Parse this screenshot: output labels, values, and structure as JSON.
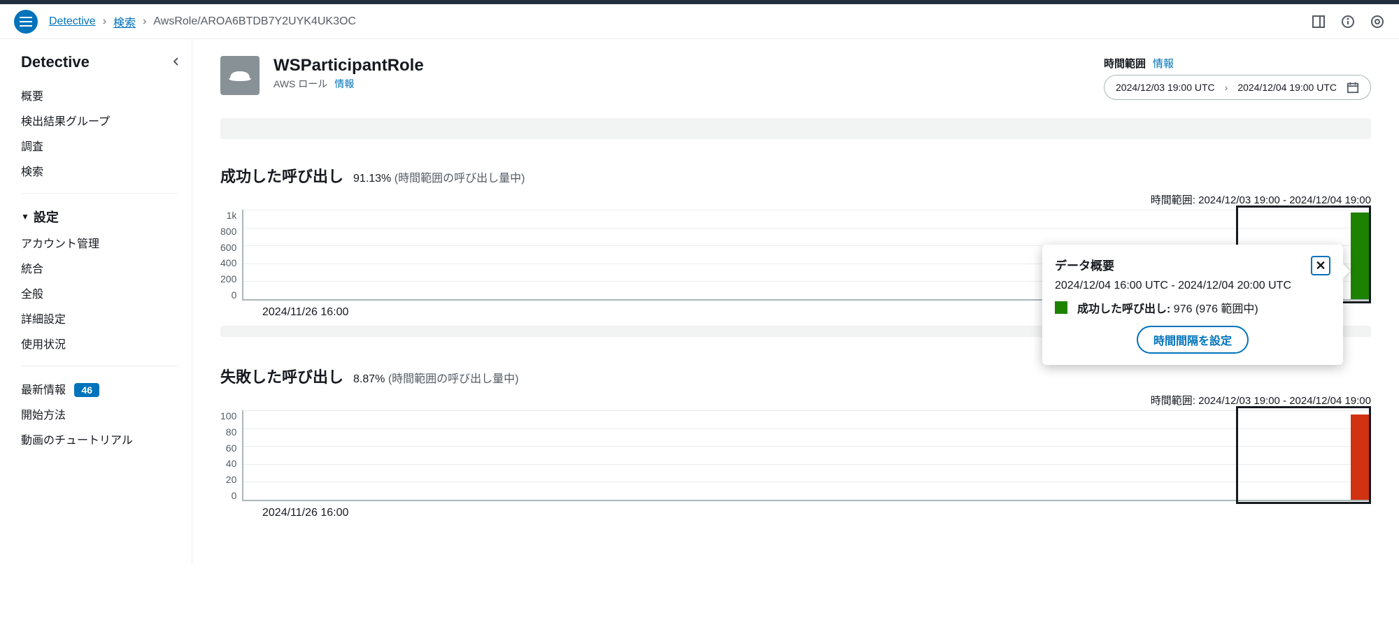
{
  "breadcrumb": {
    "root": "Detective",
    "search": "検索",
    "current": "AwsRole/AROA6BTDB7Y2UYK4UK3OC"
  },
  "sidebar": {
    "title": "Detective",
    "nav1": [
      "概要",
      "検出結果グループ",
      "調査",
      "検索"
    ],
    "settings_header": "設定",
    "settings": [
      "アカウント管理",
      "統合",
      "全般",
      "詳細設定",
      "使用状況"
    ],
    "footer": {
      "whatsnew": "最新情報",
      "whatsnew_badge": "46",
      "getting_started": "開始方法",
      "tutorials": "動画のチュートリアル"
    }
  },
  "entity": {
    "name": "WSParticipantRole",
    "type": "AWS ロール",
    "info": "情報"
  },
  "timerange": {
    "label": "時間範囲",
    "info": "情報",
    "start": "2024/12/03 19:00 UTC",
    "end": "2024/12/04 19:00 UTC"
  },
  "charts": {
    "scope_label_prefix": "時間範囲: ",
    "scope_value": "2024/12/03 19:00 - 2024/12/04 19:00",
    "x_start": "2024/11/26 16:00",
    "success": {
      "title": "成功した呼び出し",
      "pct": "91.13%",
      "pct_suffix": "(時間範囲の呼び出し量中)",
      "y_ticks": [
        "1k",
        "800",
        "600",
        "400",
        "200",
        "0"
      ]
    },
    "failed": {
      "title": "失敗した呼び出し",
      "pct": "8.87%",
      "pct_suffix": "(時間範囲の呼び出し量中)",
      "y_ticks": [
        "100",
        "80",
        "60",
        "40",
        "20",
        "0"
      ]
    }
  },
  "tooltip": {
    "title": "データ概要",
    "time": "2024/12/04 16:00 UTC - 2024/12/04 20:00 UTC",
    "legend_label": "成功した呼び出し:",
    "legend_value": "976 (976 範囲中)",
    "button": "時間間隔を設定"
  },
  "chart_data": [
    {
      "type": "bar",
      "title": "成功した呼び出し",
      "xlabel": "",
      "ylabel": "",
      "ylim": [
        0,
        1000
      ],
      "x_range_start": "2024/11/26 16:00",
      "scope": [
        "2024/12/03 19:00",
        "2024/12/04 19:00"
      ],
      "series": [
        {
          "name": "成功した呼び出し",
          "color": "#1d8102",
          "points": [
            {
              "x": "2024/12/04 16:00-20:00",
              "value": 976
            }
          ]
        }
      ],
      "percent_of_volume": 91.13
    },
    {
      "type": "bar",
      "title": "失敗した呼び出し",
      "xlabel": "",
      "ylabel": "",
      "ylim": [
        0,
        100
      ],
      "x_range_start": "2024/11/26 16:00",
      "scope": [
        "2024/12/03 19:00",
        "2024/12/04 19:00"
      ],
      "series": [
        {
          "name": "失敗した呼び出し",
          "color": "#d13212",
          "points": [
            {
              "x": "2024/12/04 16:00-20:00",
              "value": 95
            }
          ]
        }
      ],
      "percent_of_volume": 8.87
    }
  ]
}
